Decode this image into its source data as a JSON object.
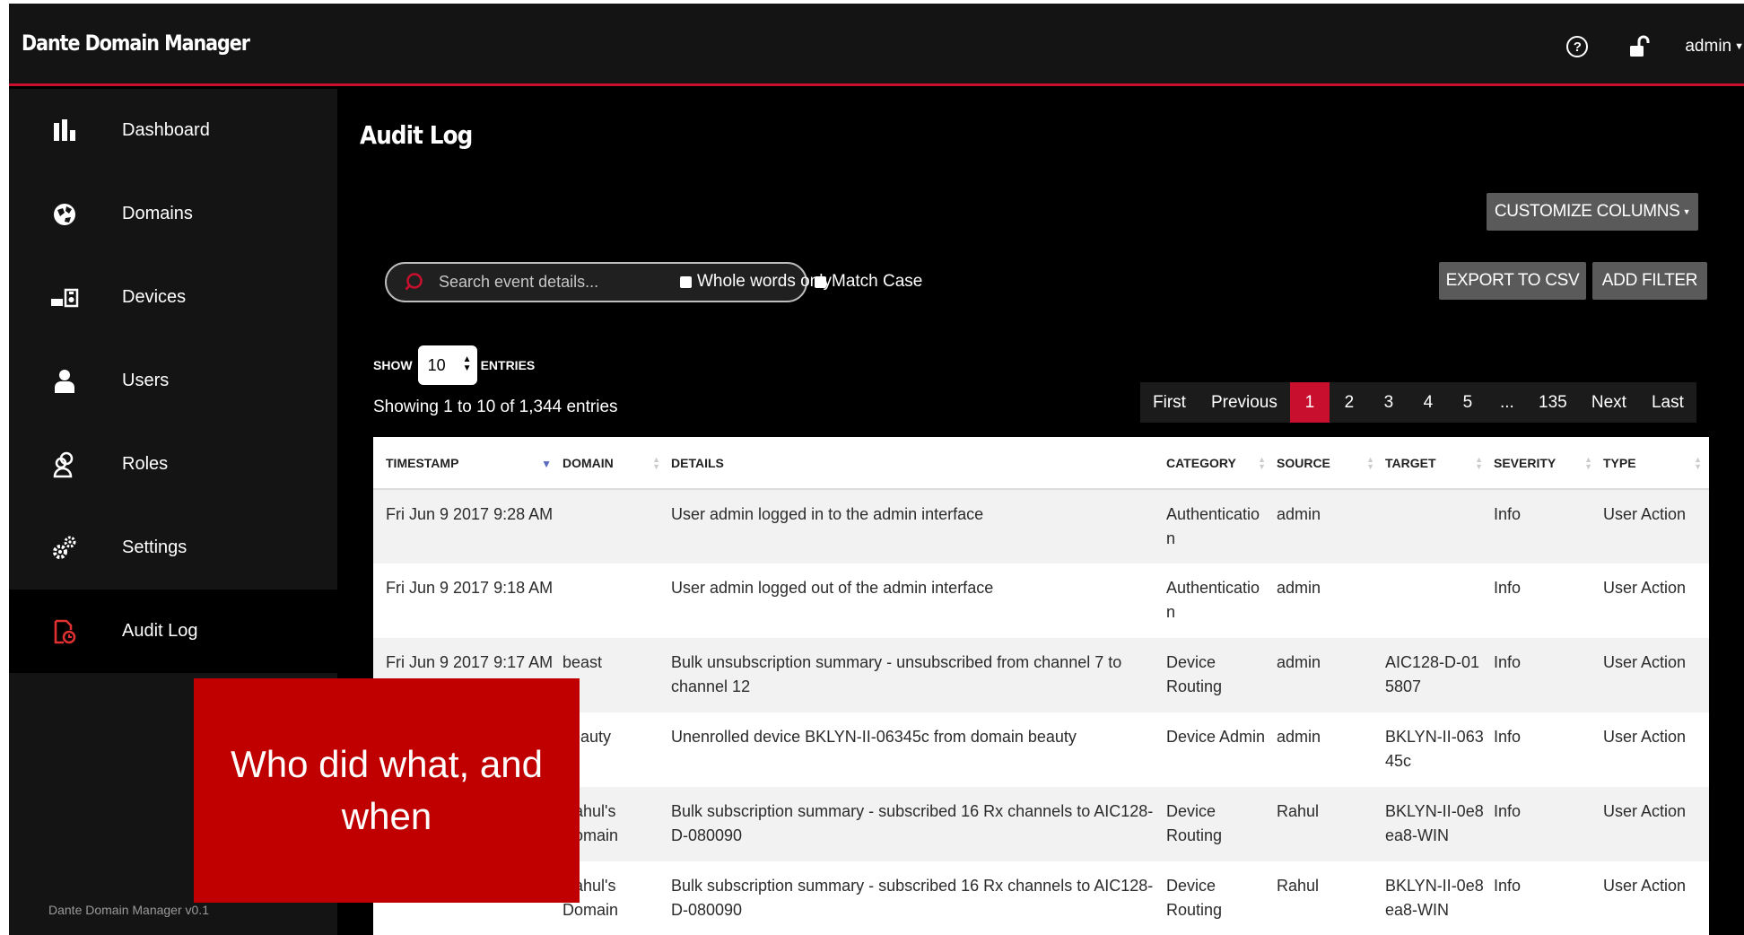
{
  "app": {
    "title": "Dante Domain Manager"
  },
  "header": {
    "user_label": "admin"
  },
  "sidebar": {
    "items": [
      {
        "label": "Dashboard",
        "icon": "bar-chart-icon"
      },
      {
        "label": "Domains",
        "icon": "globe-icon"
      },
      {
        "label": "Devices",
        "icon": "devices-icon"
      },
      {
        "label": "Users",
        "icon": "user-icon"
      },
      {
        "label": "Roles",
        "icon": "roles-icon"
      },
      {
        "label": "Settings",
        "icon": "gears-icon"
      },
      {
        "label": "Audit Log",
        "icon": "audit-log-icon",
        "active": true
      }
    ],
    "version": "Dante Domain Manager v0.1"
  },
  "page": {
    "title": "Audit Log",
    "customize_columns": "CUSTOMIZE COLUMNS",
    "export_csv": "EXPORT TO CSV",
    "add_filter": "ADD FILTER",
    "search_placeholder": "Search event details...",
    "whole_words": "Whole words only",
    "match_case": "Match Case",
    "show_label": "SHOW",
    "entries_value": "10",
    "entries_label": "ENTRIES",
    "showing_info": "Showing 1 to 10 of 1,344 entries"
  },
  "pagination": {
    "first": "First",
    "previous": "Previous",
    "pages": [
      "1",
      "2",
      "3",
      "4",
      "5",
      "...",
      "135"
    ],
    "current": "1",
    "next": "Next",
    "last": "Last"
  },
  "table": {
    "columns": [
      "TIMESTAMP",
      "DOMAIN",
      "DETAILS",
      "CATEGORY",
      "SOURCE",
      "TARGET",
      "SEVERITY",
      "TYPE"
    ],
    "rows": [
      [
        "Fri Jun 9 2017 9:28 AM",
        "",
        "User admin logged in to the admin interface",
        "Authentication",
        "admin",
        "",
        "Info",
        "User Action"
      ],
      [
        "Fri Jun 9 2017 9:18 AM",
        "",
        "User admin logged out of the admin interface",
        "Authentication",
        "admin",
        "",
        "Info",
        "User Action"
      ],
      [
        "Fri Jun 9 2017 9:17 AM",
        "beast",
        "Bulk unsubscription summary - unsubscribed from channel 7 to channel 12",
        "Device Routing",
        "admin",
        "AIC128-D-015807",
        "Info",
        "User Action"
      ],
      [
        "",
        "beauty",
        "Unenrolled device BKLYN-II-06345c from domain beauty",
        "Device Admin",
        "admin",
        "BKLYN-II-06345c",
        "Info",
        "User Action"
      ],
      [
        "",
        "Rahul's Domain",
        "Bulk subscription summary - subscribed 16 Rx channels to AIC128-D-080090",
        "Device Routing",
        "Rahul",
        "BKLYN-II-0e8ea8-WIN",
        "Info",
        "User Action"
      ],
      [
        "",
        "Rahul's Domain",
        "Bulk subscription summary - subscribed 16 Rx channels to AIC128-D-080090",
        "Device Routing",
        "Rahul",
        "BKLYN-II-0e8ea8-WIN",
        "Info",
        "User Action"
      ]
    ]
  },
  "callout": {
    "text": "Who did what, and when"
  },
  "colors": {
    "accent": "#c8102e",
    "callout": "#c00000",
    "sidebar_bg": "#141414",
    "button_bg": "#5a5a5a"
  }
}
